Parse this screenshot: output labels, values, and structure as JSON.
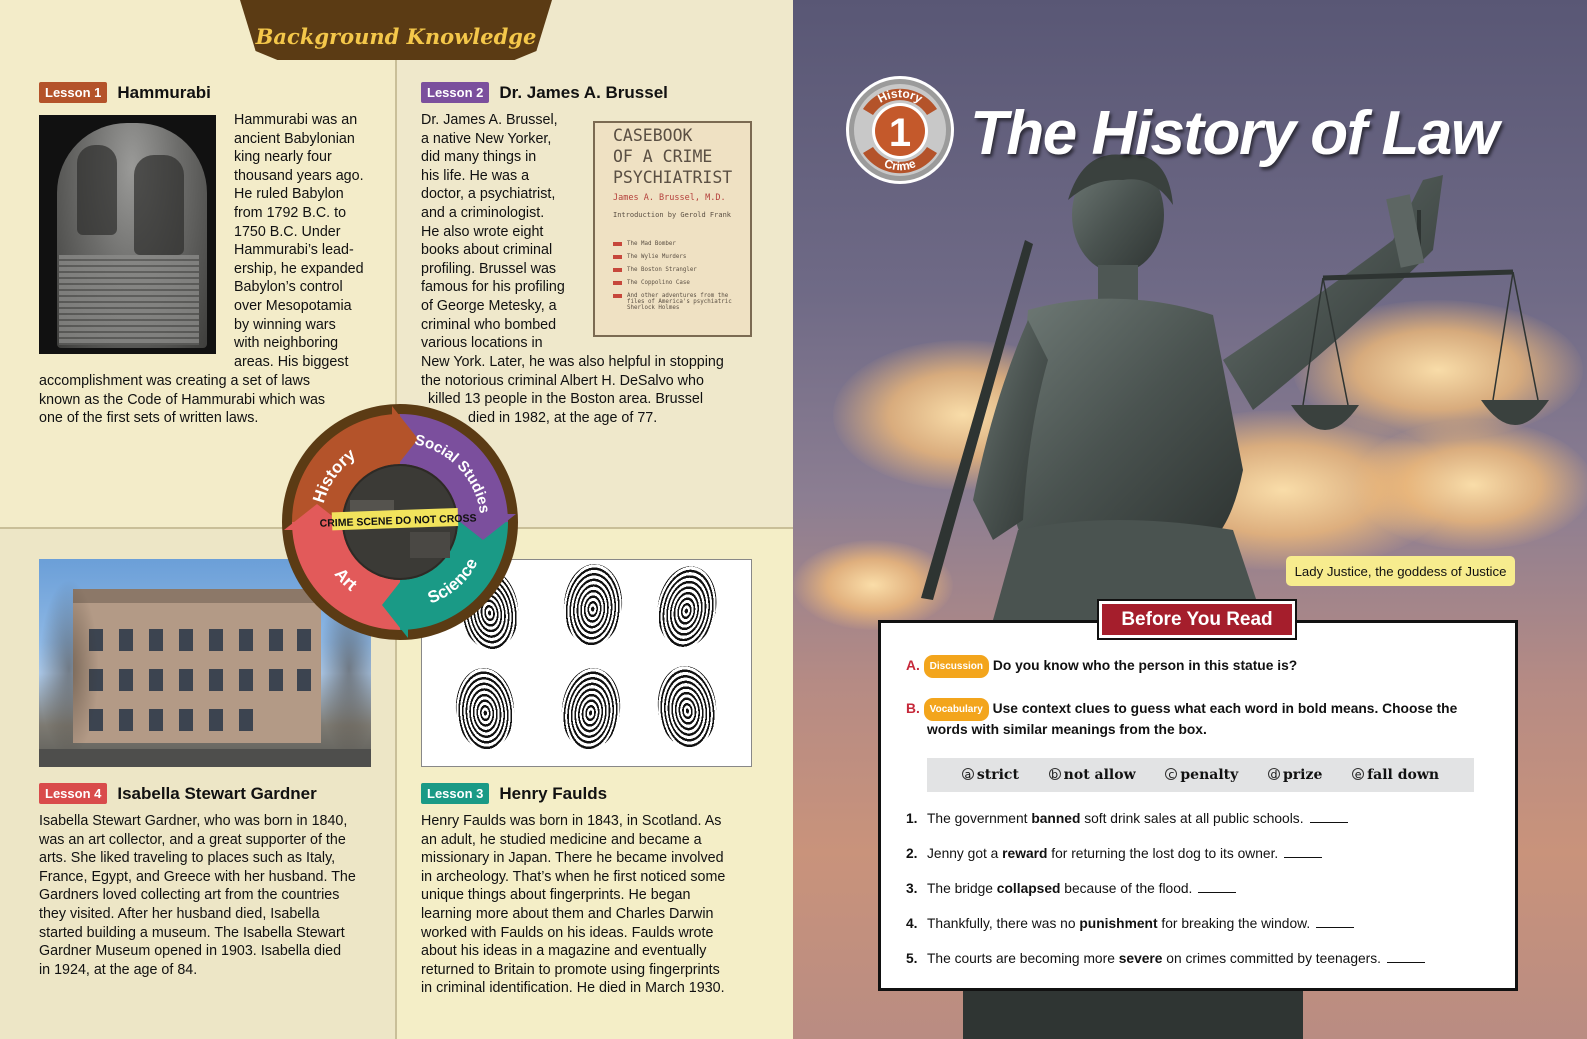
{
  "left_page": {
    "header_tab": "Background Knowledge",
    "lesson1": {
      "badge": "Lesson 1",
      "badge_color": "#b4532a",
      "name": "Hammurabi",
      "text_lines": [
        "Hammurabi was an",
        "ancient Babylonian",
        "king nearly four",
        "thousand years ago.",
        "He ruled Babylon",
        "from 1792 B.C. to",
        "1750 B.C. Under",
        "Hammurabi’s lead-",
        "ership, he expanded",
        "Babylon’s control",
        "over Mesopotamia",
        "by winning wars",
        "with neighboring",
        "areas. His biggest"
      ],
      "text_tail": [
        "accomplishment was creating a set of laws",
        "known as the Code of Hammurabi which was",
        "one of the first sets of written laws."
      ]
    },
    "lesson2": {
      "badge": "Lesson 2",
      "badge_color": "#7b4f9d",
      "name": "Dr. James A. Brussel",
      "text_lines": [
        "Dr. James A. Brussel,",
        "a native New Yorker,",
        "did many things in",
        "his life. He was a",
        "doctor, a psychiatrist,",
        "and a criminologist.",
        "He also wrote eight",
        "books about criminal",
        "profiling. Brussel was",
        "famous for his profiling",
        "of George Metesky, a",
        "criminal who bombed",
        "various locations in"
      ],
      "text_tail": [
        "New York. Later, he was also helpful in stopping",
        "the notorious criminal Albert H. DeSalvo who",
        "killed 13 people in the Boston area. Brussel",
        "died in 1982, at the age of 77."
      ],
      "book": {
        "title_lines": [
          "CASEBOOK",
          "OF A CRIME",
          "PSYCHIATRIST"
        ],
        "author": "James A. Brussel, M.D.",
        "intro": "Introduction by Gerold Frank",
        "cases": [
          "The Mad Bomber",
          "The Wylie Murders",
          "The Boston Strangler",
          "The Coppolino Case",
          "And other adventures from the files of America's psychiatric Sherlock Holmes"
        ]
      }
    },
    "lesson4": {
      "badge": "Lesson 4",
      "badge_color": "#d94b4b",
      "name": "Isabella Stewart Gardner",
      "text_lines": [
        "Isabella Stewart Gardner, who was born in 1840,",
        "was an art collector, and a great supporter of the",
        "arts. She liked traveling to places such as Italy,",
        "France, Egypt, and Greece with her husband. The",
        "Gardners loved collecting art from the countries",
        "they visited. After her husband died, Isabella",
        "started building a museum. The Isabella Stewart",
        "Gardner Museum opened in 1903. Isabella died",
        "in 1924, at the age of 84."
      ]
    },
    "lesson3": {
      "badge": "Lesson 3",
      "badge_color": "#1a9a86",
      "name": "Henry Faulds",
      "text_lines": [
        "Henry Faulds was born in 1843, in Scotland. As",
        "an adult, he studied medicine and became a",
        "missionary in Japan. There he became involved",
        "in archeology. That’s when he first noticed some",
        "unique things about fingerprints. He began",
        "learning more about them and Charles Darwin",
        "worked with Faulds on his ideas. Faulds wrote",
        "about his ideas in a magazine and eventually",
        "returned to Britain to promote using fingerprints",
        "in criminal identification. He died in March 1930."
      ]
    },
    "cycle": {
      "segments": [
        "History",
        "Social Studies",
        "Science",
        "Art"
      ],
      "colors": [
        "#b4532a",
        "#7b4f9d",
        "#1a9a86",
        "#e25a5a"
      ],
      "center_tape": "CRIME SCENE DO NOT CROSS"
    }
  },
  "right_page": {
    "badge_top": "History",
    "badge_number": "1",
    "badge_bottom": "Crime",
    "title": "The History of Law",
    "caption": "Lady Justice, the goddess of Justice",
    "before_you_read": {
      "tab": "Before You Read",
      "a_letter": "A.",
      "a_pill": "Discussion",
      "a_text": "Do you know who the person in this statue is?",
      "b_letter": "B.",
      "b_pill": "Vocabulary",
      "b_text_1": "Use context clues to guess what each word in bold means. Choose the",
      "b_text_2": "words with similar meanings from the box.",
      "choices": [
        {
          "letter": "a",
          "word": "strict"
        },
        {
          "letter": "b",
          "word": "not allow"
        },
        {
          "letter": "c",
          "word": "penalty"
        },
        {
          "letter": "d",
          "word": "prize"
        },
        {
          "letter": "e",
          "word": "fall down"
        }
      ],
      "items": [
        {
          "num": "1.",
          "before": "The government ",
          "bold": "banned",
          "after": " soft drink sales at all public schools."
        },
        {
          "num": "2.",
          "before": "Jenny got a ",
          "bold": "reward",
          "after": " for returning the lost dog to its owner."
        },
        {
          "num": "3.",
          "before": "The bridge ",
          "bold": "collapsed",
          "after": " because of the flood."
        },
        {
          "num": "4.",
          "before": "Thankfully, there was no ",
          "bold": "punishment",
          "after": " for breaking the window."
        },
        {
          "num": "5.",
          "before": "The courts are becoming more ",
          "bold": "severe",
          "after": " on crimes committed by teenagers."
        }
      ]
    }
  }
}
